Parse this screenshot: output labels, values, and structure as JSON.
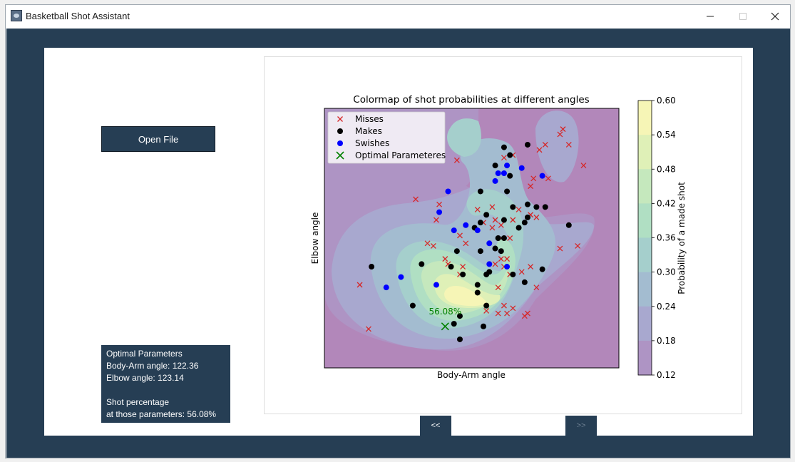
{
  "window": {
    "title": "Basketball Shot Assistant"
  },
  "controls": {
    "open_file": "Open File",
    "prev": "<<",
    "next": ">>"
  },
  "info_panel": {
    "lines": [
      "Optimal Parameters",
      "Body-Arm angle: 122.36",
      "Elbow angle: 123.14",
      "",
      "Shot percentage",
      "at those parameters: 56.08%"
    ]
  },
  "colors": {
    "frame": "#263e54",
    "miss": "#d62728",
    "make": "#000000",
    "swish": "#0000ff",
    "optimal": "#008000"
  },
  "chart_data": {
    "type": "scatter",
    "title": "Colormap of shot probabilities at different angles",
    "xlabel": "Body-Arm angle",
    "ylabel": "Elbow angle",
    "background": "contour colormap of predicted shot probability",
    "colorbar": {
      "label": "Probability of a made shot",
      "ticks": [
        "0.60",
        "0.54",
        "0.48",
        "0.42",
        "0.36",
        "0.30",
        "0.24",
        "0.18",
        "0.12"
      ],
      "colors": [
        "#f6f5b6",
        "#dff0b7",
        "#c5e8bd",
        "#b0dfc3",
        "#a5cfcc",
        "#a3bcd0",
        "#a8a8cf",
        "#ae94c4",
        "#b287ba"
      ]
    },
    "legend": {
      "placement": "upper left",
      "entries": [
        "Misses",
        "Makes",
        "Swishes",
        "Optimal Parameteres"
      ]
    },
    "axes_ticks": "none",
    "series": [
      {
        "name": "Misses",
        "marker": "x",
        "points": [
          [
            0.15,
            0.15
          ],
          [
            0.12,
            0.32
          ],
          [
            0.31,
            0.65
          ],
          [
            0.68,
            0.2
          ],
          [
            0.55,
            0.22
          ],
          [
            0.61,
            0.24
          ],
          [
            0.62,
            0.21
          ],
          [
            0.59,
            0.21
          ],
          [
            0.69,
            0.21
          ],
          [
            0.59,
            0.31
          ],
          [
            0.72,
            0.31
          ],
          [
            0.64,
            0.23
          ],
          [
            0.58,
            0.4
          ],
          [
            0.62,
            0.42
          ],
          [
            0.6,
            0.42
          ],
          [
            0.67,
            0.37
          ],
          [
            0.7,
            0.39
          ],
          [
            0.46,
            0.36
          ],
          [
            0.47,
            0.39
          ],
          [
            0.6,
            0.5
          ],
          [
            0.8,
            0.46
          ],
          [
            0.86,
            0.47
          ],
          [
            0.76,
            0.73
          ],
          [
            0.88,
            0.78
          ],
          [
            0.83,
            0.86
          ],
          [
            0.75,
            0.86
          ],
          [
            0.71,
            0.73
          ],
          [
            0.73,
            0.84
          ],
          [
            0.8,
            0.9
          ],
          [
            0.81,
            0.92
          ],
          [
            0.61,
            0.81
          ],
          [
            0.57,
            0.54
          ],
          [
            0.54,
            0.56
          ],
          [
            0.52,
            0.61
          ],
          [
            0.57,
            0.62
          ],
          [
            0.58,
            0.57
          ],
          [
            0.6,
            0.55
          ],
          [
            0.66,
            0.61
          ],
          [
            0.7,
            0.59
          ],
          [
            0.72,
            0.58
          ],
          [
            0.64,
            0.57
          ],
          [
            0.45,
            0.8
          ],
          [
            0.39,
            0.63
          ],
          [
            0.38,
            0.57
          ],
          [
            0.35,
            0.48
          ],
          [
            0.37,
            0.47
          ],
          [
            0.41,
            0.42
          ],
          [
            0.42,
            0.4
          ],
          [
            0.46,
            0.51
          ],
          [
            0.48,
            0.48
          ],
          [
            0.63,
            0.5
          ],
          [
            0.61,
            0.39
          ],
          [
            0.63,
            0.36
          ],
          [
            0.7,
            0.7
          ],
          [
            0.64,
            0.82
          ]
        ]
      },
      {
        "name": "Makes",
        "marker": "o",
        "points": [
          [
            0.45,
            0.45
          ],
          [
            0.43,
            0.39
          ],
          [
            0.52,
            0.32
          ],
          [
            0.47,
            0.36
          ],
          [
            0.53,
            0.45
          ],
          [
            0.53,
            0.68
          ],
          [
            0.55,
            0.59
          ],
          [
            0.58,
            0.46
          ],
          [
            0.64,
            0.36
          ],
          [
            0.68,
            0.33
          ],
          [
            0.55,
            0.36
          ],
          [
            0.56,
            0.37
          ],
          [
            0.59,
            0.5
          ],
          [
            0.61,
            0.5
          ],
          [
            0.53,
            0.56
          ],
          [
            0.51,
            0.54
          ],
          [
            0.64,
            0.62
          ],
          [
            0.63,
            0.74
          ],
          [
            0.66,
            0.54
          ],
          [
            0.68,
            0.56
          ],
          [
            0.72,
            0.62
          ],
          [
            0.69,
            0.63
          ],
          [
            0.75,
            0.62
          ],
          [
            0.61,
            0.57
          ],
          [
            0.6,
            0.45
          ],
          [
            0.63,
            0.82
          ],
          [
            0.58,
            0.78
          ],
          [
            0.62,
            0.68
          ],
          [
            0.46,
            0.2
          ],
          [
            0.44,
            0.17
          ],
          [
            0.3,
            0.24
          ],
          [
            0.54,
            0.16
          ],
          [
            0.55,
            0.24
          ],
          [
            0.46,
            0.11
          ],
          [
            0.52,
            0.29
          ],
          [
            0.16,
            0.39
          ],
          [
            0.33,
            0.4
          ],
          [
            0.69,
            0.58
          ],
          [
            0.83,
            0.55
          ],
          [
            0.74,
            0.38
          ],
          [
            0.61,
            0.85
          ],
          [
            0.69,
            0.86
          ]
        ]
      },
      {
        "name": "Swishes",
        "marker": "o",
        "points": [
          [
            0.21,
            0.31
          ],
          [
            0.26,
            0.35
          ],
          [
            0.38,
            0.32
          ],
          [
            0.52,
            0.53
          ],
          [
            0.48,
            0.55
          ],
          [
            0.44,
            0.53
          ],
          [
            0.42,
            0.68
          ],
          [
            0.39,
            0.6
          ],
          [
            0.56,
            0.4
          ],
          [
            0.62,
            0.39
          ],
          [
            0.56,
            0.48
          ],
          [
            0.58,
            0.72
          ],
          [
            0.59,
            0.75
          ],
          [
            0.61,
            0.75
          ],
          [
            0.62,
            0.78
          ],
          [
            0.67,
            0.77
          ],
          [
            0.74,
            0.74
          ]
        ]
      },
      {
        "name": "Optimal Parameteres",
        "marker": "x",
        "points": [
          [
            0.41,
            0.16
          ]
        ],
        "label": "56.08%"
      }
    ]
  }
}
